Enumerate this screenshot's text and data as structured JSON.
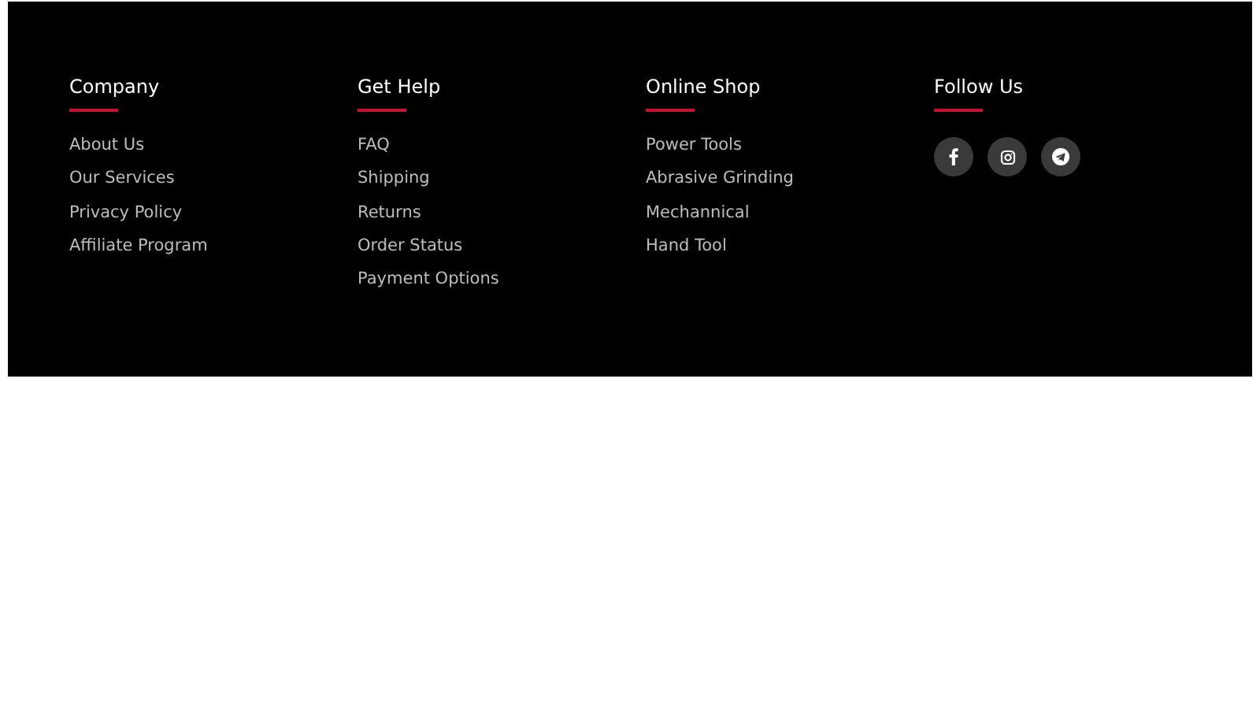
{
  "footer": {
    "columns": [
      {
        "heading": "Company",
        "links": [
          "About Us",
          "Our Services",
          "Privacy Policy",
          "Affiliate Program"
        ]
      },
      {
        "heading": "Get Help",
        "links": [
          "FAQ",
          "Shipping",
          "Returns",
          "Order Status",
          "Payment Options"
        ]
      },
      {
        "heading": "Online Shop",
        "links": [
          "Power Tools",
          "Abrasive Grinding",
          "Mechannical",
          "Hand Tool"
        ]
      },
      {
        "heading": "Follow Us",
        "social": [
          {
            "kind": "facebook"
          },
          {
            "kind": "instagram"
          },
          {
            "kind": "telegram"
          }
        ]
      }
    ]
  }
}
